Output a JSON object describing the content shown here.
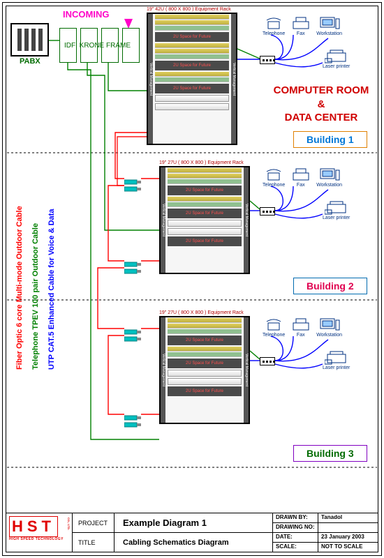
{
  "header": {
    "incoming": "INCOMING",
    "idf_label": "IDF; KRONE FRAME",
    "pabx": "PABX"
  },
  "room_title": {
    "line1": "COMPUTER ROOM",
    "amp": "&",
    "line2": "DATA CENTER"
  },
  "racks": [
    {
      "caption": "19\" 42U ( 800 X 800 ) Equipment Rack",
      "vertical_label": "Vertical Management",
      "future": "2U Space for Future"
    },
    {
      "caption": "19\" 27U ( 800 X 800 ) Equipment Rack",
      "vertical_label": "Vertical Management",
      "future": "2U Space for Future"
    },
    {
      "caption": "19\" 27U ( 800 X 800 ) Equipment Rack",
      "vertical_label": "Vertical Management",
      "future": "2U Space for Future"
    }
  ],
  "buildings": [
    {
      "label": "Building 1"
    },
    {
      "label": "Building 2"
    },
    {
      "label": "Building 3"
    }
  ],
  "devices": {
    "telephone": "Telephone",
    "fax": "Fax",
    "workstation": "Workstation",
    "printer": "Laser printer"
  },
  "legend": {
    "fiber": "Fiber Optic 6 core Multi-mode Outdoor Cable",
    "telephone": "Telephone TPEV 100 pair Outdoor Cable",
    "utp": "UTP CAT.5 Enhanced Cable for Voice & Data"
  },
  "cable_colors": {
    "fiber": "#ff0000",
    "telephone": "#008000",
    "utp": "#0000ff"
  },
  "titleblock": {
    "logo": "HST",
    "logo_side": "CO., LTD.",
    "logo_sub": "HIGH SPEED TECHNOLOGY",
    "project_label": "PROJECT",
    "project_value": "Example Diagram 1",
    "title_label": "TITLE",
    "title_value": "Cabling Schematics Diagram",
    "drawn_by_label": "DRAWN BY:",
    "drawn_by": "Tanadol",
    "drawing_no_label": "DRAWING NO:",
    "drawing_no": "",
    "date_label": "DATE:",
    "date": "23 January 2003",
    "scale_label": "SCALE:",
    "scale": "NOT TO SCALE"
  }
}
